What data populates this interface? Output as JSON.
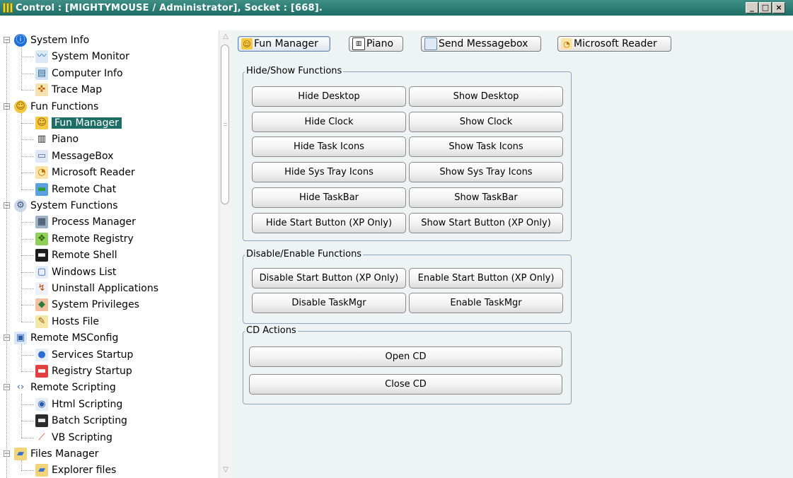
{
  "window": {
    "title": "Control : [MIGHTYMOUSE / Administrator], Socket : [668].",
    "controls": {
      "minimize": "_",
      "maximize": "□",
      "close": "×"
    }
  },
  "sidebar": {
    "sections": [
      {
        "label": "System Info",
        "icon": "info-icon",
        "children": [
          "System Monitor",
          "Computer Info",
          "Trace Map"
        ]
      },
      {
        "label": "Fun Functions",
        "icon": "smiley-icon",
        "children": [
          "Fun Manager",
          "Piano",
          "MessageBox",
          "Microsoft Reader",
          "Remote Chat"
        ]
      },
      {
        "label": "System Functions",
        "icon": "gears-icon",
        "children": [
          "Process Manager",
          "Remote Registry",
          "Remote Shell",
          "Windows List",
          "Uninstall Applications",
          "System Privileges",
          "Hosts File"
        ]
      },
      {
        "label": "Remote MSConfig",
        "icon": "msconfig-icon",
        "children": [
          "Services Startup",
          "Registry Startup"
        ]
      },
      {
        "label": "Remote Scripting",
        "icon": "script-icon",
        "children": [
          "Html Scripting",
          "Batch Scripting",
          "VB Scripting"
        ]
      },
      {
        "label": "Files Manager",
        "icon": "folder-icon",
        "children": [
          "Explorer files"
        ]
      }
    ],
    "selected": "Fun Manager"
  },
  "tabs": [
    {
      "label": "Fun Manager",
      "icon": "smiley-icon",
      "active": true
    },
    {
      "label": "Piano",
      "icon": "piano-icon",
      "active": false
    },
    {
      "label": "Send Messagebox",
      "icon": "messagebox-icon",
      "active": false
    },
    {
      "label": "Microsoft Reader",
      "icon": "reader-icon",
      "active": false
    }
  ],
  "groups": {
    "hide_show": {
      "title": "Hide/Show Functions",
      "buttons": [
        [
          "Hide Desktop",
          "Show Desktop"
        ],
        [
          "Hide Clock",
          "Show Clock"
        ],
        [
          "Hide Task Icons",
          "Show Task Icons"
        ],
        [
          "Hide Sys Tray Icons",
          "Show Sys Tray Icons"
        ],
        [
          "Hide TaskBar",
          "Show TaskBar"
        ],
        [
          "Hide Start Button (XP Only)",
          "Show Start Button (XP Only)"
        ]
      ]
    },
    "disable_enable": {
      "title": "Disable/Enable Functions",
      "buttons": [
        [
          "Disable Start Button (XP Only)",
          "Enable Start Button (XP Only)"
        ],
        [
          "Disable TaskMgr",
          "Enable TaskMgr"
        ]
      ]
    },
    "cd": {
      "title": "CD Actions",
      "buttons": [
        "Open CD",
        "Close CD"
      ]
    }
  }
}
